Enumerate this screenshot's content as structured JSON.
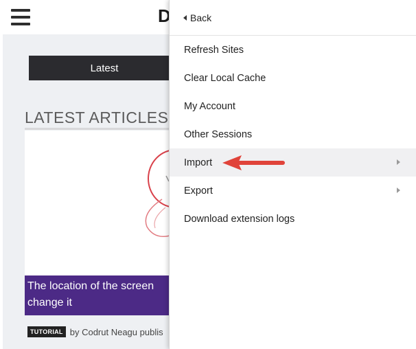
{
  "site": {
    "logo_text": "D",
    "latest_tab_label": "Latest",
    "section_heading": "LATEST ARTICLES",
    "article": {
      "title": "The location of the screen change it",
      "tag": "TUTORIAL",
      "byline": "by Codrut Neagu publis"
    }
  },
  "menu": {
    "back_label": "Back",
    "items": [
      {
        "label": "Refresh Sites",
        "has_submenu": false
      },
      {
        "label": "Clear Local Cache",
        "has_submenu": false
      },
      {
        "label": "My Account",
        "has_submenu": false
      },
      {
        "label": "Other Sessions",
        "has_submenu": false
      },
      {
        "label": "Import",
        "has_submenu": true,
        "highlighted": true
      },
      {
        "label": "Export",
        "has_submenu": true
      },
      {
        "label": "Download extension logs",
        "has_submenu": false
      }
    ]
  },
  "annotation": {
    "arrow_color": "#e0433a",
    "arrow_icon": "red-pointer-arrow-icon"
  },
  "colors": {
    "article_title_bg": "#4c2a86",
    "tab_bg": "#2b2b2f"
  }
}
